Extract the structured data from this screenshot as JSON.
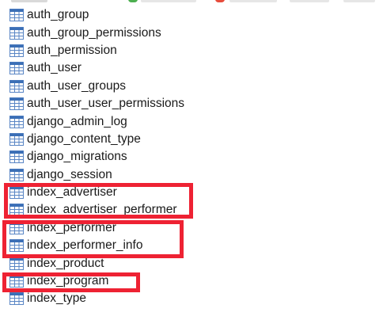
{
  "table_list": {
    "items": [
      {
        "name": "auth_group",
        "icon": "table-icon"
      },
      {
        "name": "auth_group_permissions",
        "icon": "table-icon"
      },
      {
        "name": "auth_permission",
        "icon": "table-icon"
      },
      {
        "name": "auth_user",
        "icon": "table-icon"
      },
      {
        "name": "auth_user_groups",
        "icon": "table-icon"
      },
      {
        "name": "auth_user_user_permissions",
        "icon": "table-icon"
      },
      {
        "name": "django_admin_log",
        "icon": "table-icon"
      },
      {
        "name": "django_content_type",
        "icon": "table-icon"
      },
      {
        "name": "django_migrations",
        "icon": "table-icon"
      },
      {
        "name": "django_session",
        "icon": "table-icon"
      },
      {
        "name": "index_advertiser",
        "icon": "table-icon"
      },
      {
        "name": "index_advertiser_performer",
        "icon": "table-icon"
      },
      {
        "name": "index_performer",
        "icon": "table-icon"
      },
      {
        "name": "index_performer_info",
        "icon": "table-icon"
      },
      {
        "name": "index_product",
        "icon": "table-icon"
      },
      {
        "name": "index_program",
        "icon": "table-icon"
      },
      {
        "name": "index_type",
        "icon": "table-icon"
      }
    ]
  },
  "colors": {
    "icon_header": "#3b6fb6",
    "icon_grid": "#5a86c5",
    "highlight_border": "#ee2233",
    "text": "#1a1a1a"
  }
}
